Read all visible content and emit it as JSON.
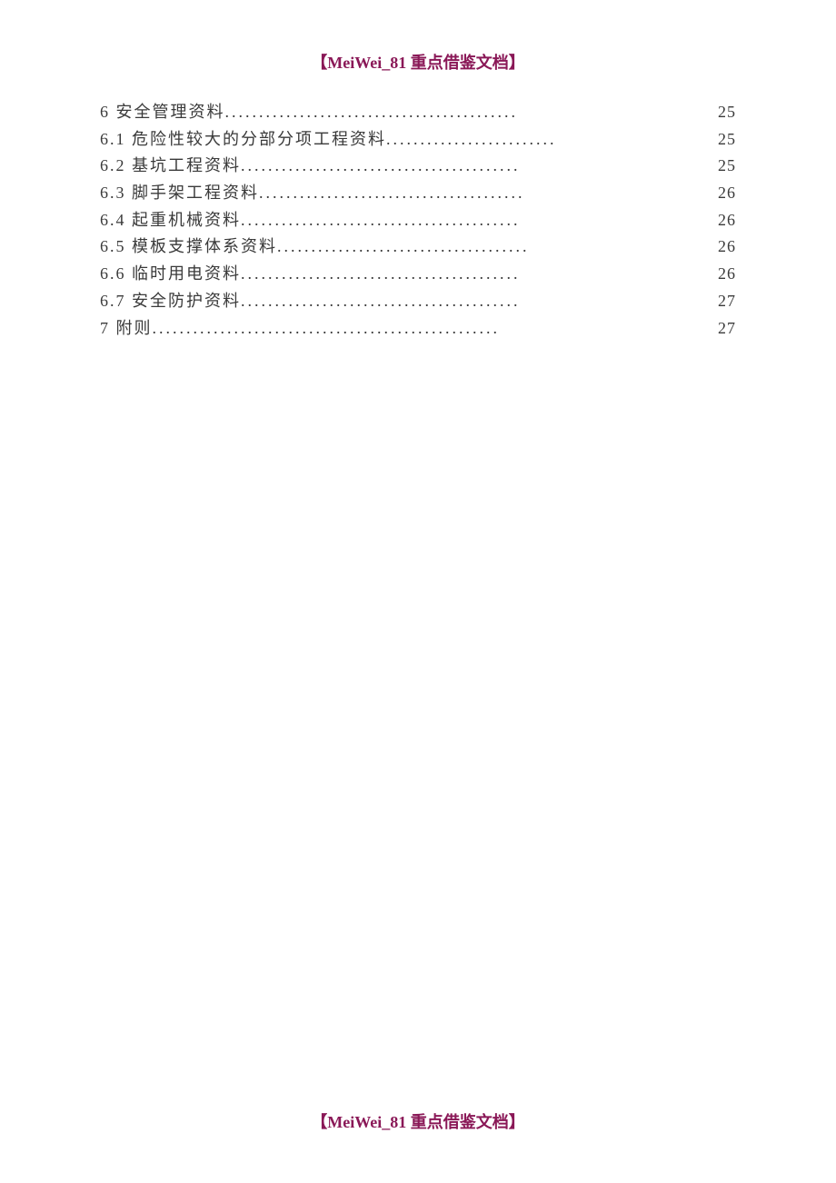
{
  "header": {
    "text": "【MeiWei_81 重点借鉴文档】"
  },
  "footer": {
    "text": "【MeiWei_81 重点借鉴文档】"
  },
  "toc": {
    "entries": [
      {
        "title": "6 安全管理资料",
        "page": "25"
      },
      {
        "title": "6.1 危险性较大的分部分项工程资料",
        "page": "25"
      },
      {
        "title": "6.2 基坑工程资料",
        "page": "25"
      },
      {
        "title": "6.3 脚手架工程资料",
        "page": "26"
      },
      {
        "title": "6.4 起重机械资料",
        "page": "26"
      },
      {
        "title": "6.5 模板支撑体系资料",
        "page": "26"
      },
      {
        "title": "6.6 临时用电资料",
        "page": "26"
      },
      {
        "title": "6.7 安全防护资料",
        "page": "27"
      },
      {
        "title": "7 附则",
        "page": "27"
      }
    ]
  }
}
